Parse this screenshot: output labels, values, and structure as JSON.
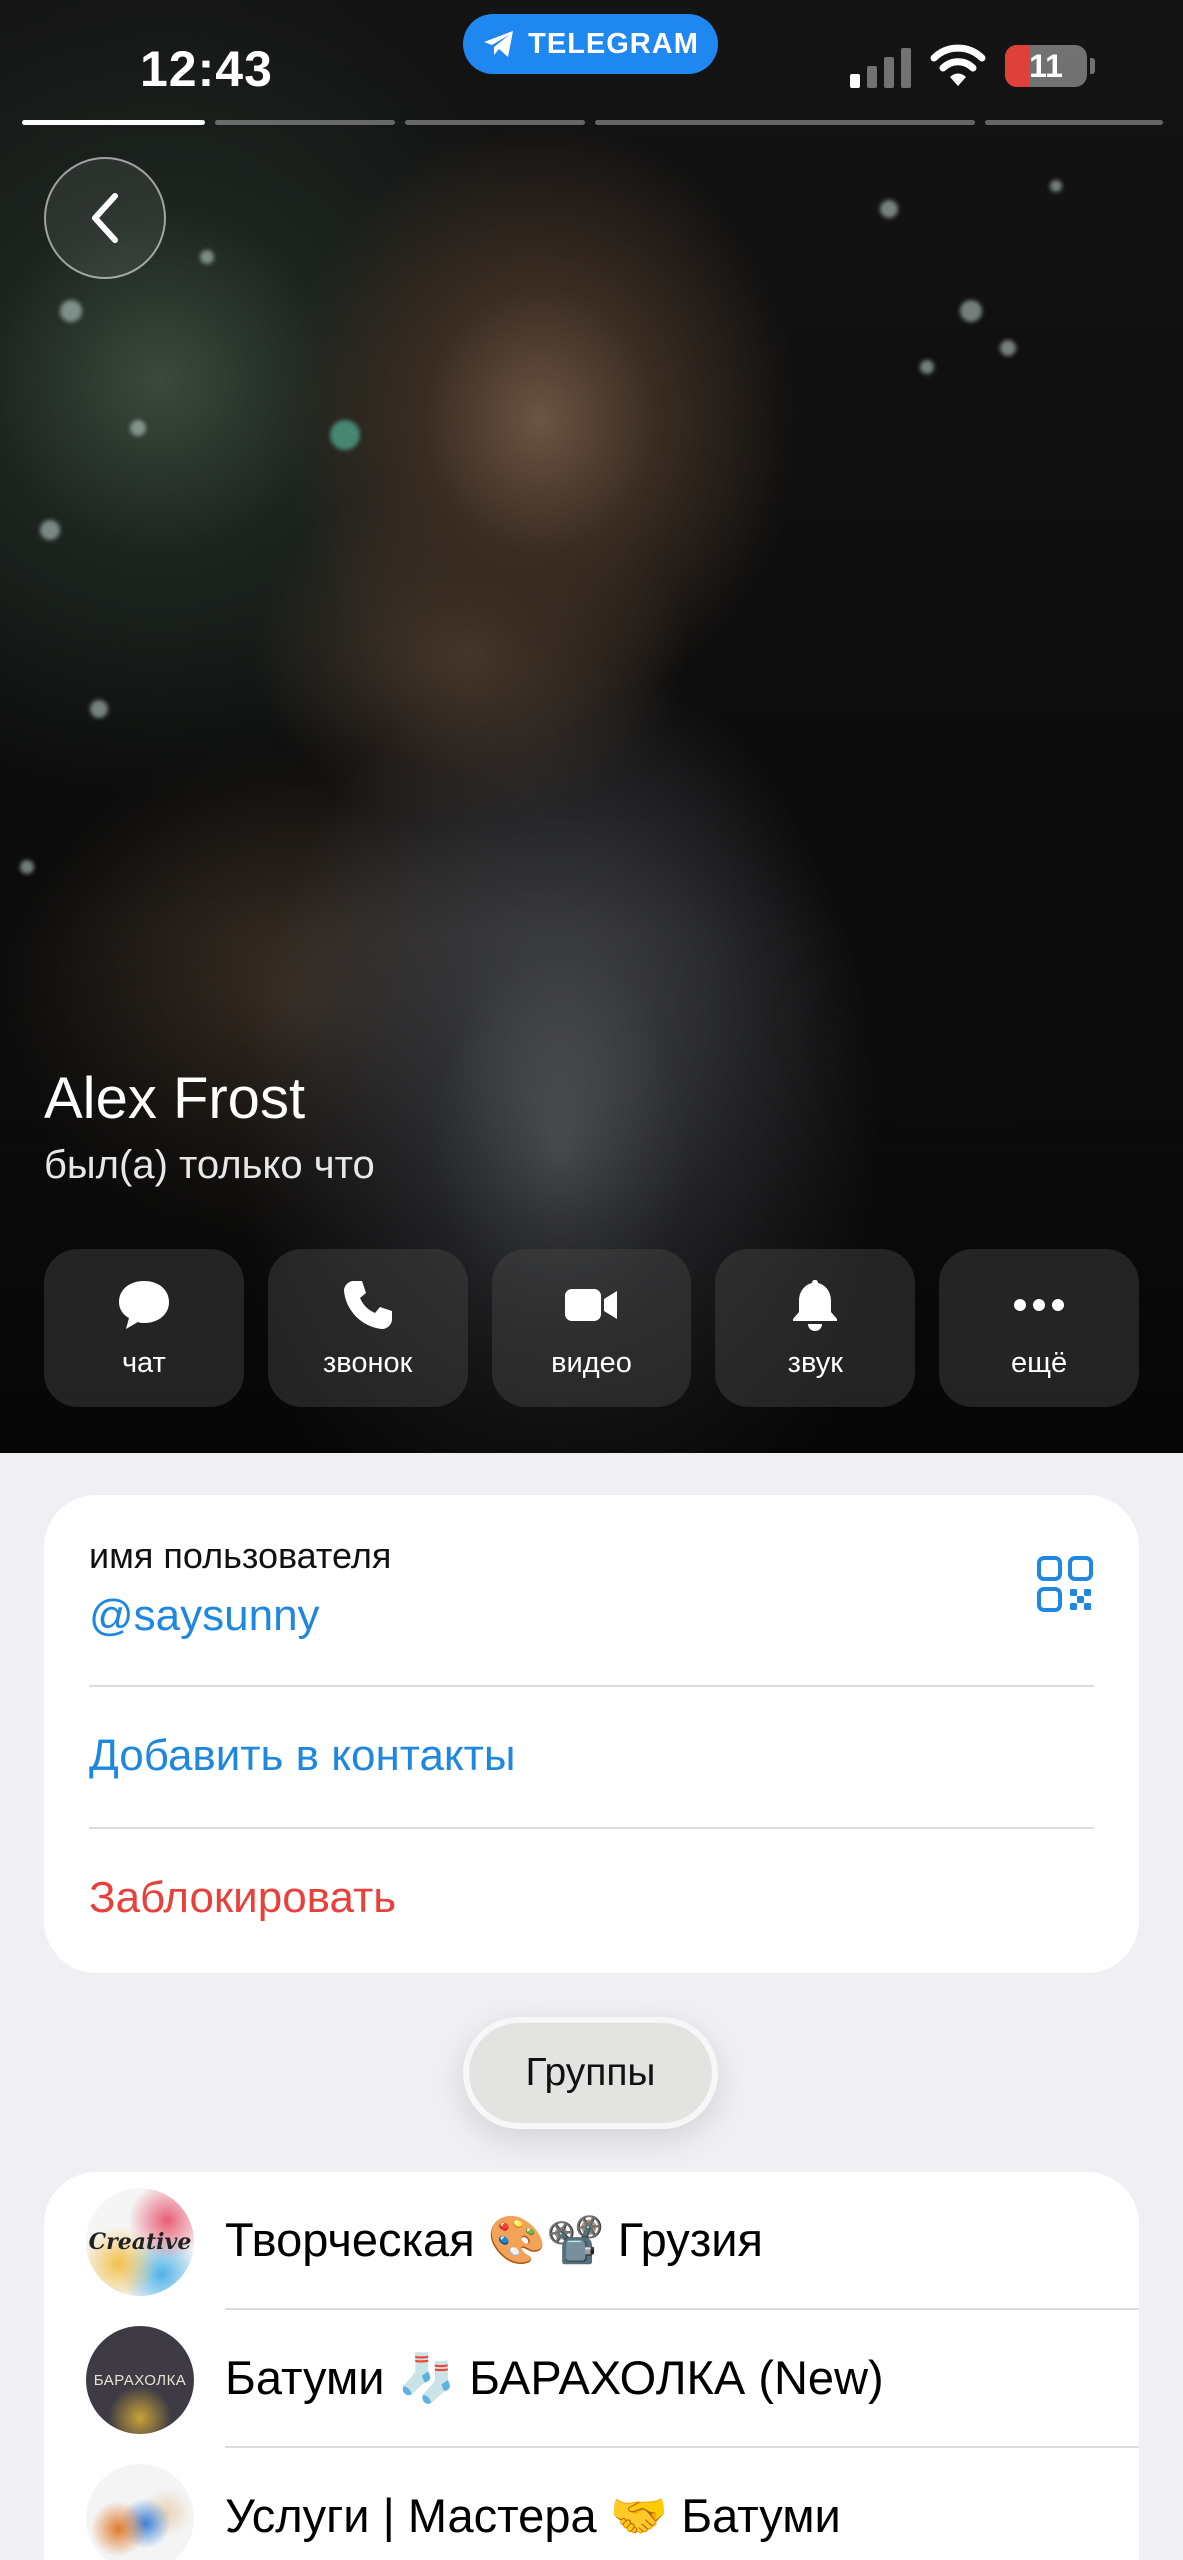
{
  "status_bar": {
    "time": "12:43",
    "app_pill": "TELEGRAM",
    "battery_level": "11",
    "battery_fraction": 0.11
  },
  "stories": {
    "count": 5,
    "active_index": 0
  },
  "profile": {
    "name": "Alex Frost",
    "status": "был(а) только что"
  },
  "actions": [
    {
      "label": "чат",
      "icon": "chat-bubble-icon"
    },
    {
      "label": "звонок",
      "icon": "phone-icon"
    },
    {
      "label": "видео",
      "icon": "video-camera-icon"
    },
    {
      "label": "звук",
      "icon": "bell-icon"
    },
    {
      "label": "ещё",
      "icon": "more-dots-icon"
    }
  ],
  "info": {
    "username_label": "имя пользователя",
    "username": "@saysunny",
    "add_contact": "Добавить в контакты",
    "block": "Заблокировать"
  },
  "groups_tab": "Группы",
  "groups": [
    {
      "title": "Творческая 🎨📽️ Грузия",
      "avatar_text": "Creative"
    },
    {
      "title": "Батуми 🧦 БАРАХОЛКА (New)",
      "avatar_text": "БАРАХОЛКА"
    },
    {
      "title": "Услуги | Мастера 🤝 Батуми",
      "avatar_text": ""
    }
  ],
  "colors": {
    "accent": "#1e87e0",
    "danger": "#e8403a",
    "telegram_pill": "#1e87f0",
    "background": "#efeff4"
  }
}
